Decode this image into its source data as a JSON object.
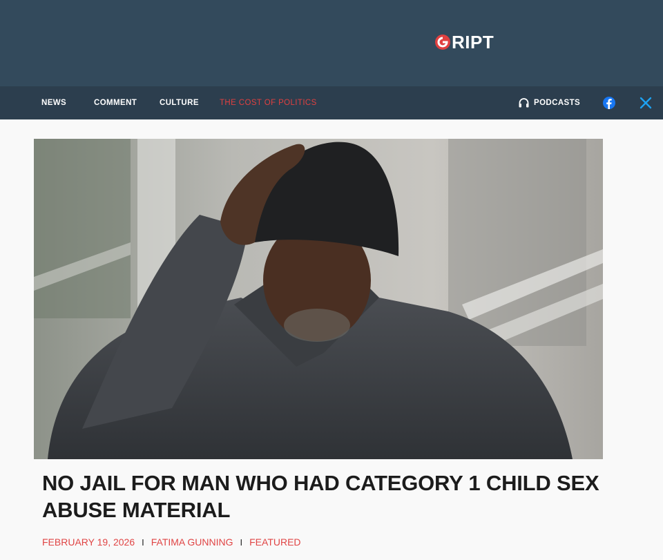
{
  "header": {
    "logo_text": "RIPT",
    "logo_icon": "gript-g-icon",
    "background": "#334a5c"
  },
  "nav": {
    "items": [
      {
        "label": "NEWS"
      },
      {
        "label": "COMMENT"
      },
      {
        "label": "CULTURE"
      },
      {
        "label": "THE COST OF POLITICS",
        "color": "#e04040"
      }
    ],
    "podcasts_label": "PODCASTS",
    "podcasts_icon": "headphones-icon",
    "social": [
      {
        "icon": "facebook-icon",
        "color": "#1877f2"
      },
      {
        "icon": "x-icon",
        "color": "#1da1f2"
      }
    ],
    "background": "#2c3e4e"
  },
  "article": {
    "hero_image": "man-in-beanie-and-coat-photo",
    "title": "NO JAIL FOR MAN WHO HAD CATEGORY 1 CHILD SEX ABUSE MATERIAL",
    "date": "FEBRUARY 19, 2026",
    "author": "FATIMA GUNNING",
    "category": "FEATURED",
    "separator": "I",
    "accent": "#e04444"
  }
}
